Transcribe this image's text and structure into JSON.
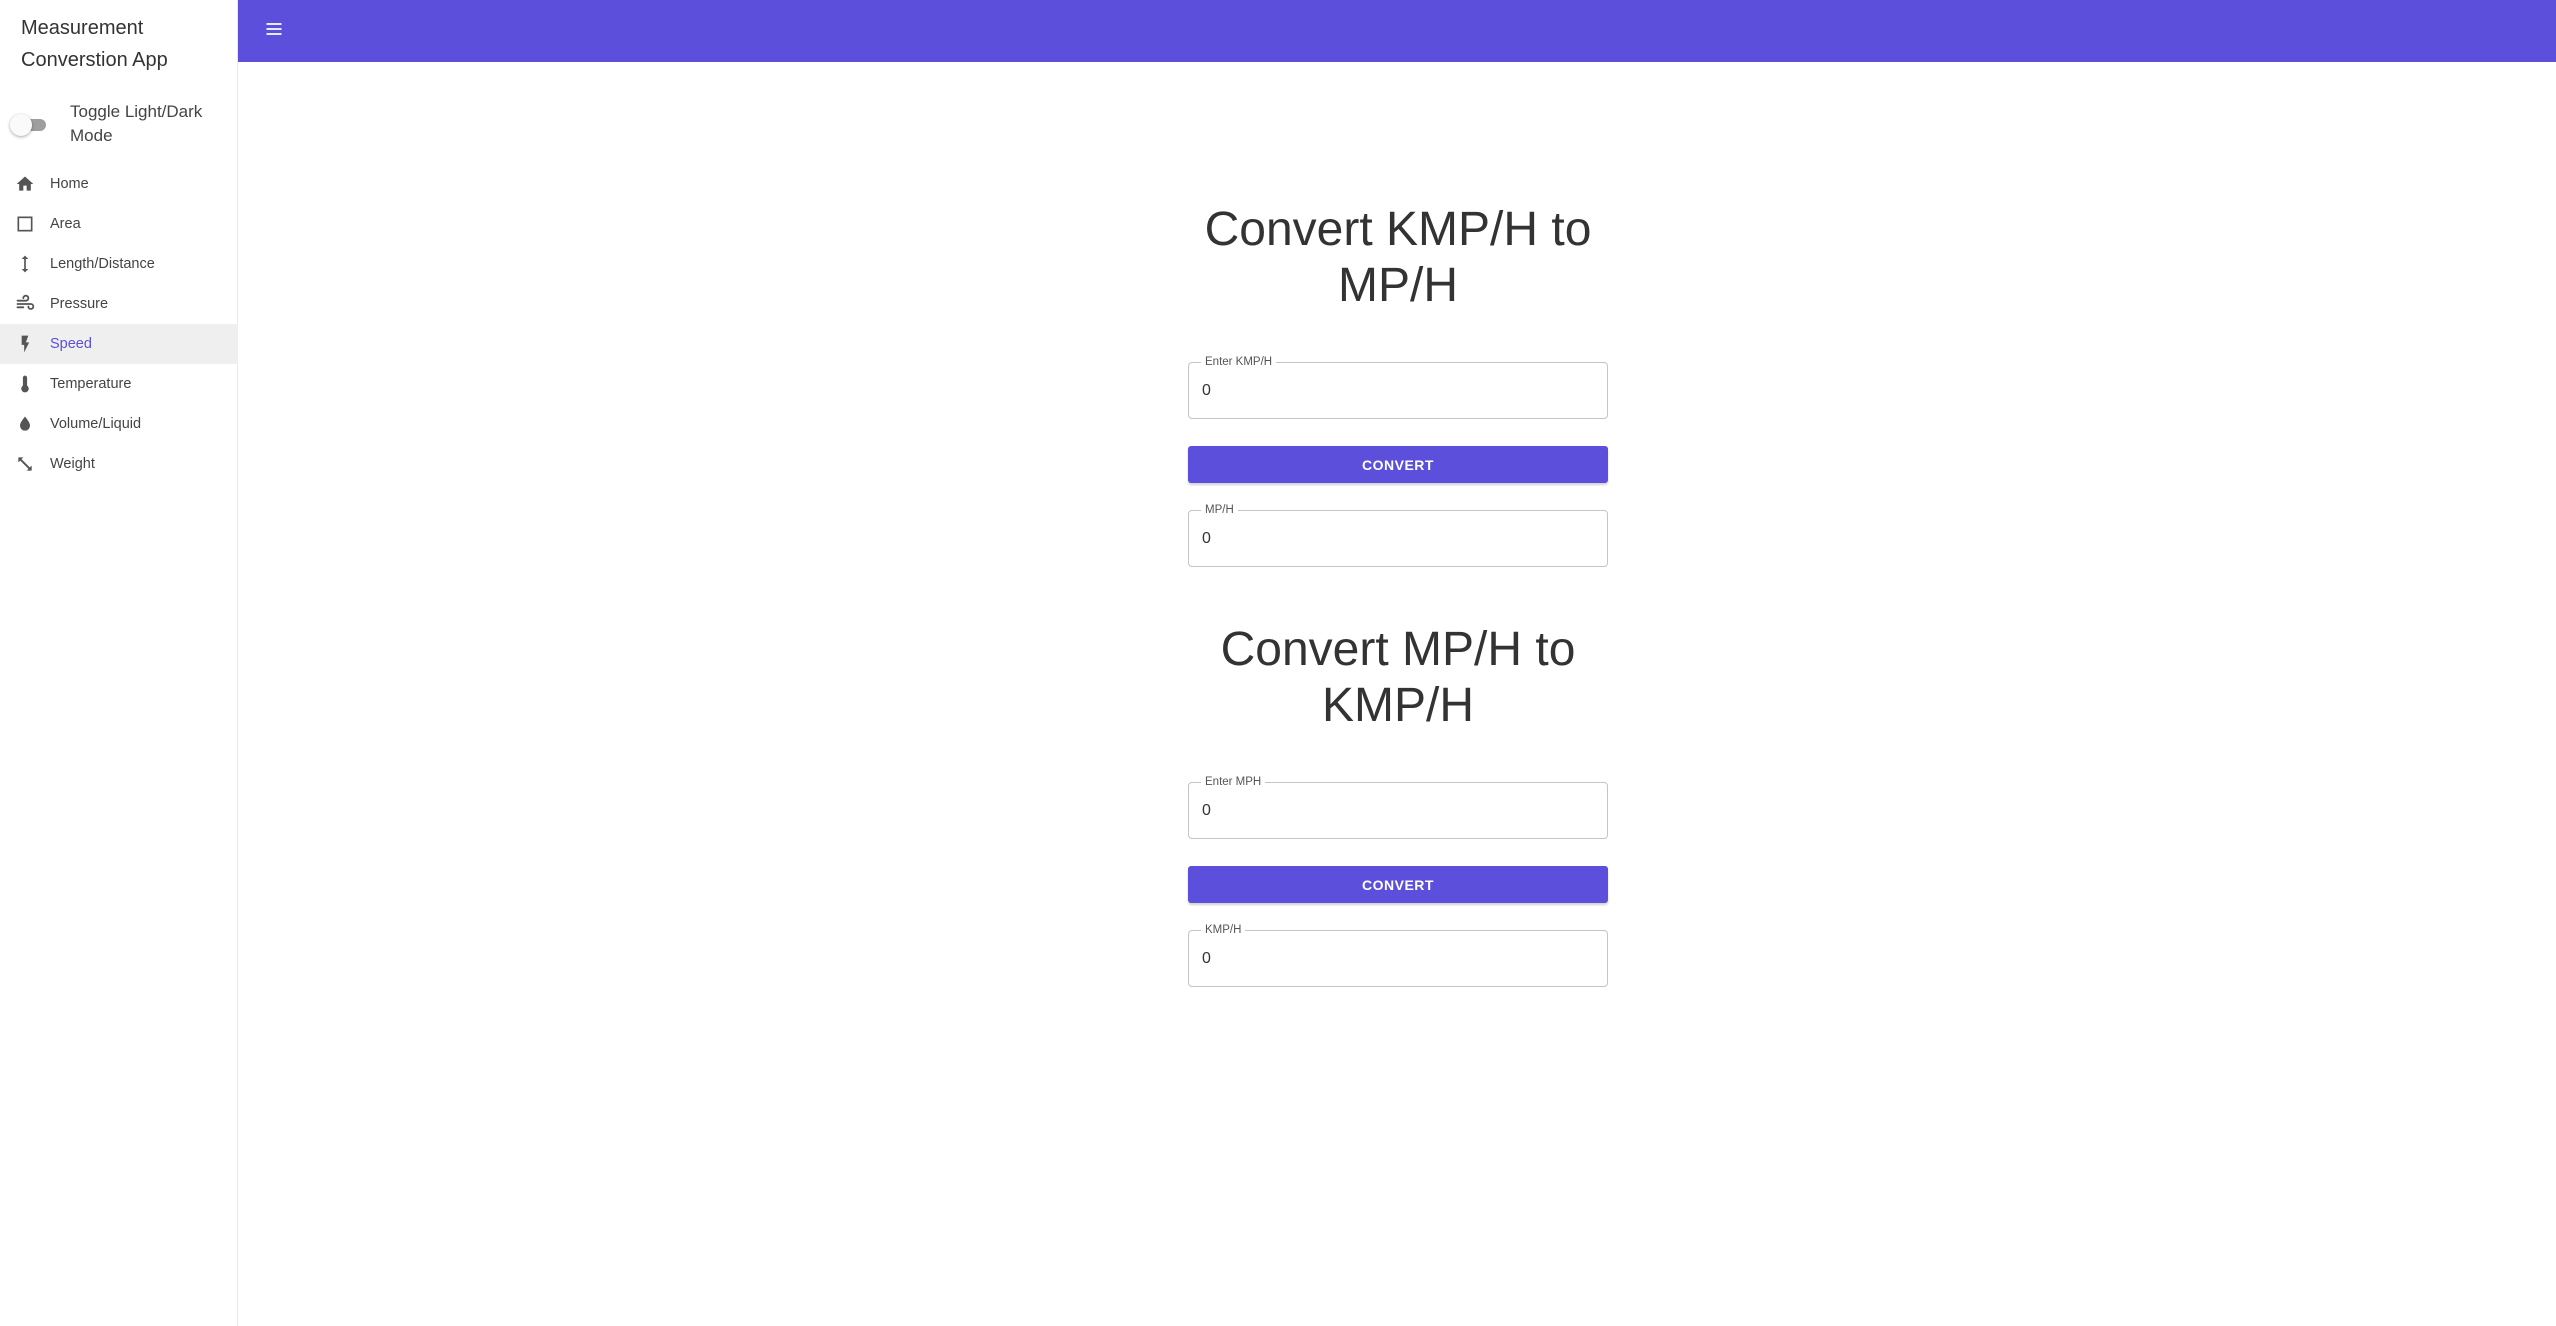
{
  "app_title": "Measurement Converstion App",
  "theme_toggle": {
    "label": "Toggle Light/Dark Mode",
    "checked": false
  },
  "colors": {
    "accent": "#5b4fdc",
    "active_bg": "#efefef"
  },
  "nav": {
    "active": "Speed",
    "items": [
      {
        "label": "Home",
        "icon": "home-icon"
      },
      {
        "label": "Area",
        "icon": "square-outline-icon"
      },
      {
        "label": "Length/Distance",
        "icon": "vertical-arrows-icon"
      },
      {
        "label": "Pressure",
        "icon": "air-icon"
      },
      {
        "label": "Speed",
        "icon": "bolt-icon"
      },
      {
        "label": "Temperature",
        "icon": "thermometer-icon"
      },
      {
        "label": "Volume/Liquid",
        "icon": "water-drop-icon"
      },
      {
        "label": "Weight",
        "icon": "diagonal-resize-icon"
      }
    ]
  },
  "topbar": {
    "menu_icon": "menu-icon"
  },
  "kmph_to_mph": {
    "heading": "Convert KMP/H to MP/H",
    "input": {
      "label": "Enter KMP/H",
      "value": "0"
    },
    "button": "CONVERT",
    "output": {
      "label": "MP/H",
      "value": "0"
    }
  },
  "mph_to_kmph": {
    "heading": "Convert MP/H to KMP/H",
    "input": {
      "label": "Enter MPH",
      "value": "0"
    },
    "button": "CONVERT",
    "output": {
      "label": "KMP/H",
      "value": "0"
    }
  }
}
